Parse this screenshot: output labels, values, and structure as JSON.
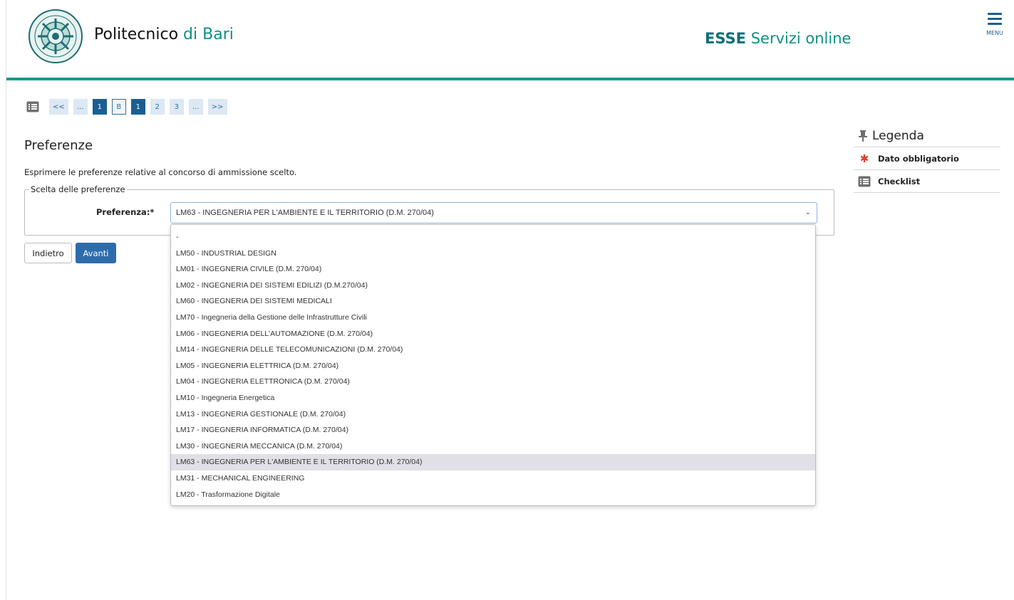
{
  "header": {
    "logo_main": "Politecnico",
    "logo_accent": "di Bari",
    "service_bold": "ESSE",
    "service_rest": "Servizi online",
    "menu_label": "MENU",
    "accent_color": "#149b8b"
  },
  "pager": {
    "icon": "list-icon",
    "items": [
      {
        "label": "<<",
        "state": "normal"
      },
      {
        "label": "...",
        "state": "normal"
      },
      {
        "label": "1",
        "state": "active"
      },
      {
        "label": "B",
        "state": "outlined"
      },
      {
        "label": "1",
        "state": "active"
      },
      {
        "label": "2",
        "state": "normal"
      },
      {
        "label": "3",
        "state": "normal"
      },
      {
        "label": "...",
        "state": "normal"
      },
      {
        "label": ">>",
        "state": "normal"
      }
    ]
  },
  "main": {
    "title": "Preferenze",
    "instructions": "Esprimere le preferenze relative al concorso di ammissione scelto.",
    "fieldset_legend": "Scelta delle preferenze",
    "preference_label": "Preferenza:*",
    "selected_value": "LM63 - INGEGNERIA PER L'AMBIENTE E IL TERRITORIO (D.M. 270/04)",
    "options": [
      "-",
      "LM50 - INDUSTRIAL DESIGN",
      "LM01 - INGEGNERIA CIVILE (D.M. 270/04)",
      "LM02 - INGEGNERIA DEI SISTEMI EDILIZI (D.M.270/04)",
      "LM60 - INGEGNERIA DEI SISTEMI MEDICALI",
      "LM70 - Ingegneria della Gestione delle Infrastrutture Civili",
      "LM06 - INGEGNERIA DELL'AUTOMAZIONE (D.M. 270/04)",
      "LM14 - INGEGNERIA DELLE TELECOMUNICAZIONI (D.M. 270/04)",
      "LM05 - INGEGNERIA ELETTRICA (D.M. 270/04)",
      "LM04 - INGEGNERIA ELETTRONICA (D.M. 270/04)",
      "LM10 - Ingegneria Energetica",
      "LM13 - INGEGNERIA GESTIONALE (D.M. 270/04)",
      "LM17 - INGEGNERIA INFORMATICA (D.M. 270/04)",
      "LM30 - INGEGNERIA MECCANICA (D.M. 270/04)",
      "LM63 - INGEGNERIA PER L'AMBIENTE E IL TERRITORIO (D.M. 270/04)",
      "LM31 - MECHANICAL ENGINEERING",
      "LM20 - Trasformazione Digitale"
    ],
    "selected_index": 14,
    "back_label": "Indietro",
    "next_label": "Avanti"
  },
  "legend": {
    "title": "Legenda",
    "items": [
      {
        "icon": "required-star-icon",
        "label": "Dato obbligatorio"
      },
      {
        "icon": "checklist-icon",
        "label": "Checklist"
      }
    ],
    "star_color": "#d9402b"
  }
}
